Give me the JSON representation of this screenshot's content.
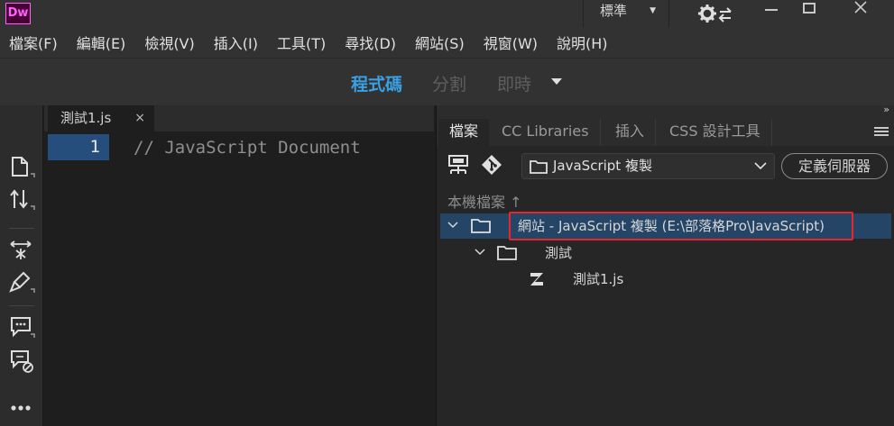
{
  "app": {
    "logo": "Dw",
    "workspace": "標準"
  },
  "menu": [
    "檔案(F)",
    "編輯(E)",
    "檢視(V)",
    "插入(I)",
    "工具(T)",
    "尋找(D)",
    "網站(S)",
    "視窗(W)",
    "說明(H)"
  ],
  "view": {
    "code": "程式碼",
    "split": "分割",
    "live": "即時"
  },
  "document": {
    "tab_name": "測試1.js",
    "close_glyph": "×",
    "line_number": "1",
    "code_text": "// JavaScript Document"
  },
  "panel": {
    "collapse_glyph": "››",
    "tabs": [
      "檔案",
      "CC Libraries",
      "插入",
      "CSS 設計工具"
    ],
    "site_select": "JavaScript 複製",
    "define_server": "定義伺服器",
    "local_files": "本機檔案",
    "tree": {
      "site": "網站 - JavaScript 複製 (E:\\部落格Pro\\JavaScript)",
      "folder": "測試",
      "file": "測試1.js"
    }
  },
  "colors": {
    "accent": "#3a9fe3",
    "highlight_border": "#e8262c",
    "selected_row": "#254566",
    "line_highlight": "#254e7d",
    "logo_magenta": "#ff61f6"
  },
  "icons": [
    "sync-settings-icon",
    "minimize-icon",
    "maximize-icon",
    "close-icon",
    "new-document-icon",
    "file-transfer-icon",
    "expand-code-icon",
    "format-code-icon",
    "comment-icon",
    "remove-comment-icon",
    "more-icon",
    "connect-server-icon",
    "git-icon",
    "folder-icon",
    "chevron-down-icon",
    "js-file-icon",
    "panel-menu-icon"
  ]
}
